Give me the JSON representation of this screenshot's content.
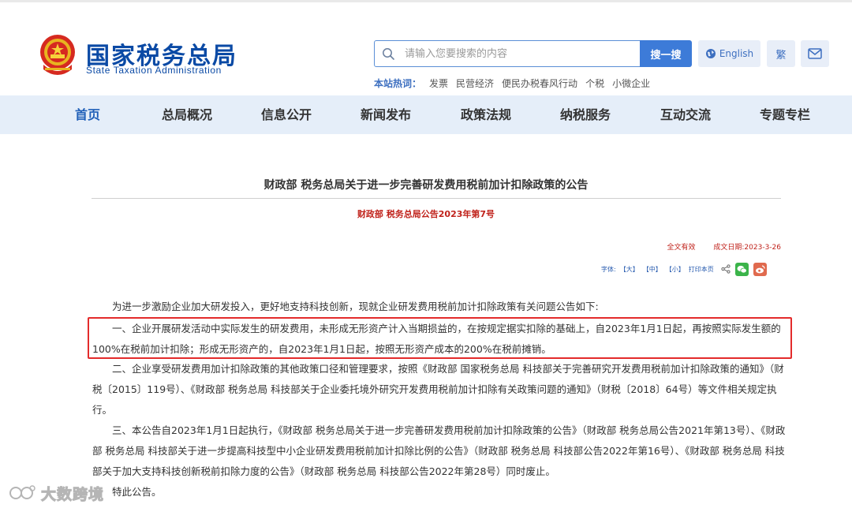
{
  "header": {
    "logo_cn": "国家税务总局",
    "logo_en": "State Taxation Administration",
    "search_placeholder": "请输入您要搜索的内容",
    "search_button": "搜一搜",
    "english_label": "English",
    "traditional_label": "繁",
    "hot_label": "本站热词：",
    "hot_words": [
      "发票",
      "民营经济",
      "便民办税春风行动",
      "个税",
      "小微企业"
    ]
  },
  "nav": {
    "items": [
      "首页",
      "总局概况",
      "信息公开",
      "新闻发布",
      "政策法规",
      "纳税服务",
      "互动交流",
      "专题专栏"
    ],
    "active_index": 0
  },
  "article": {
    "title": "财政部 税务总局关于进一步完善研发费用税前加计扣除政策的公告",
    "subtitle": "财政部 税务总局公告2023年第7号",
    "validity": "全文有效",
    "date_label": "成文日期:",
    "date_value": "2023-3-26",
    "tools": {
      "font_label": "字体:",
      "large": "【大】",
      "medium": "【中】",
      "small": "【小】",
      "print": "打印本页"
    },
    "paragraphs": [
      "为进一步激励企业加大研发投入，更好地支持科技创新，现就企业研发费用税前加计扣除政策有关问题公告如下:",
      "一、企业开展研发活动中实际发生的研发费用，未形成无形资产计入当期损益的，在按规定据实扣除的基础上，自2023年1月1日起，再按照实际发生额的100%在税前加计扣除；形成无形资产的，自2023年1月1日起，按照无形资产成本的200%在税前摊销。",
      "二、企业享受研发费用加计扣除政策的其他政策口径和管理要求，按照《财政部 国家税务总局 科技部关于完善研究开发费用税前加计扣除政策的通知》（财税〔2015〕119号）、《财政部 税务总局 科技部关于企业委托境外研究开发费用税前加计扣除有关政策问题的通知》（财税〔2018〕64号）等文件相关规定执行。",
      "三、本公告自2023年1月1日起执行，《财政部 税务总局关于进一步完善研发费用税前加计扣除政策的公告》（财政部 税务总局公告2021年第13号）、《财政部 税务总局 科技部关于进一步提高科技型中小企业研发费用税前加计扣除比例的公告》（财政部 税务总局 科技部公告2022年第16号）、《财政部 税务总局 科技部关于加大支持科技创新税前扣除力度的公告》（财政部 税务总局 科技部公告2022年第28号）同时废止。",
      "特此公告。"
    ]
  },
  "watermark": "大数跨境",
  "colors": {
    "brand_blue": "#0b4aa5",
    "nav_bg": "#e5eef9",
    "accent_red": "#c0221b",
    "highlight_border": "#e32b2b"
  }
}
